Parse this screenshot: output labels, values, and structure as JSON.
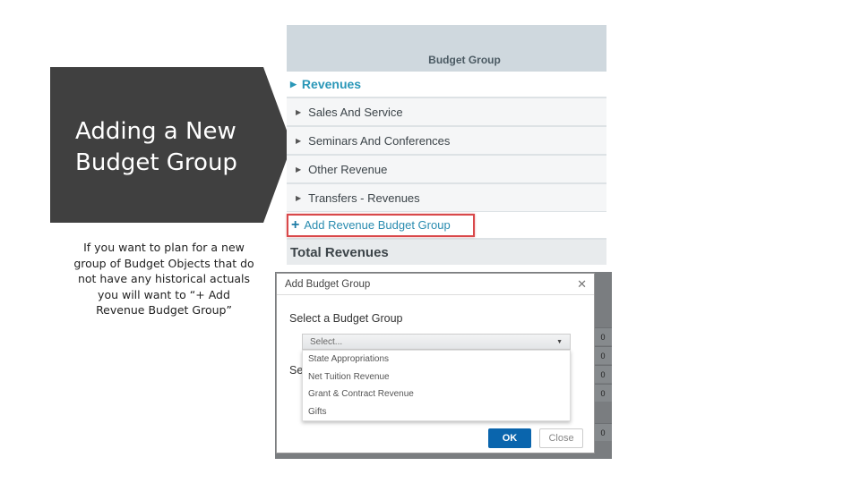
{
  "slide": {
    "title_line1": "Adding a New",
    "title_line2": "Budget Group",
    "description": "If you want to plan for a new group of Budget Objects that do not have any historical actuals you will want to “+ Add Revenue Budget Group”"
  },
  "panel": {
    "header": "Budget Group",
    "section": "Revenues",
    "groups": [
      {
        "label": "Sales And Service"
      },
      {
        "label": "Seminars And Conferences"
      },
      {
        "label": "Other Revenue"
      },
      {
        "label": "Transfers - Revenues"
      }
    ],
    "add_link": "Add Revenue Budget Group",
    "add_icon": "plus-icon",
    "total": "Total Revenues",
    "highlight_color": "#d9484a",
    "accent_color": "#2a97b8"
  },
  "background_values": [
    "0",
    "0",
    "0",
    "0",
    "0"
  ],
  "modal": {
    "title": "Add Budget Group",
    "close_icon": "close-icon",
    "select_label": "Select a Budget Group",
    "second_label": "Se",
    "select_placeholder": "Select...",
    "options": [
      {
        "label": "State Appropriations"
      },
      {
        "label": "Net Tuition Revenue"
      },
      {
        "label": "Grant & Contract Revenue"
      },
      {
        "label": "Gifts"
      }
    ],
    "ok_label": "OK",
    "close_label": "Close",
    "ok_color": "#0a65ad"
  }
}
